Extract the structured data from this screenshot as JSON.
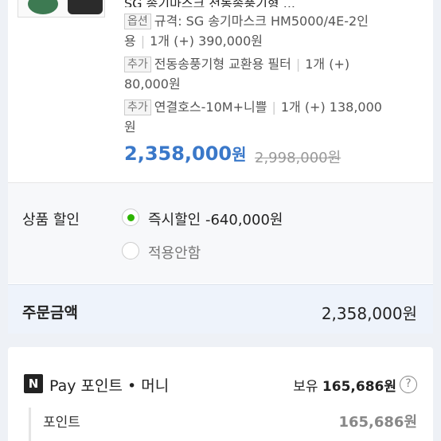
{
  "product": {
    "title_cut": "SG 송기마스크 전동송풍기형 ...",
    "options": [
      {
        "tag": "옵션",
        "text_line1": "규격: SG 송기마스크 HM5000/4E-2인",
        "text_line2": "용",
        "qty": "1개 (+) 390,000원"
      },
      {
        "tag": "추가",
        "text_line1": "전동송풍기형 교환용 필터",
        "qty_line1": "1개 (+)",
        "text_line2": "80,000원"
      },
      {
        "tag": "추가",
        "text_line1": "연결호스-10M+니쁠",
        "qty_line1": "1개 (+) 138,000",
        "text_line2": "원"
      }
    ],
    "price": "2,358,000",
    "price_unit": "원",
    "original_price": "2,998,000원"
  },
  "discount": {
    "label": "상품 할인",
    "options": [
      {
        "label": "즉시할인 -640,000원",
        "selected": true
      },
      {
        "label": "적용안함",
        "selected": false
      }
    ]
  },
  "total": {
    "label": "주문금액",
    "value": "2,358,000원"
  },
  "npay": {
    "logo": "N",
    "title": "Pay 포인트 • 머니",
    "hold_prefix": "보유",
    "hold_amount": "165,686원",
    "help_icon": "?",
    "point_label": "포인트",
    "point_value": "165,686원"
  },
  "colors": {
    "accent_blue": "#3a78c9",
    "radio_green": "#2db400"
  }
}
